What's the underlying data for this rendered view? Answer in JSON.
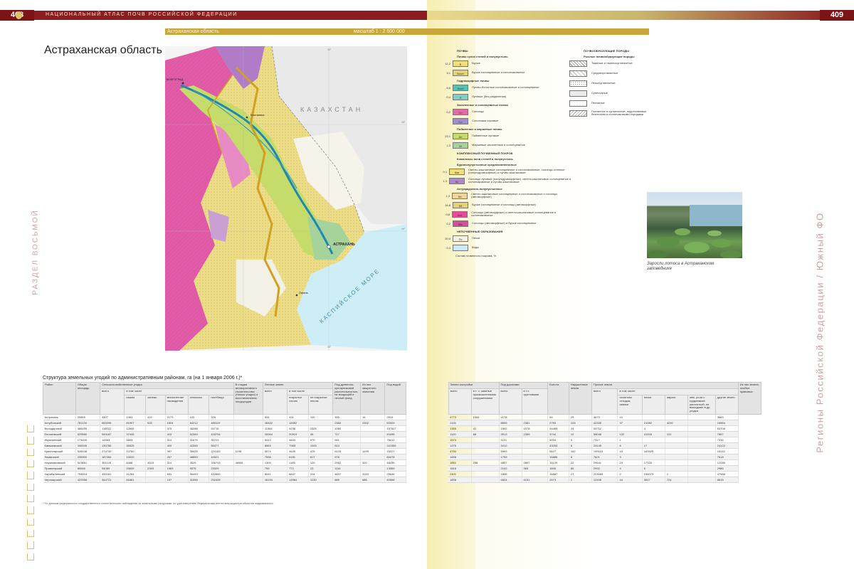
{
  "header": {
    "left_page": "408",
    "right_page": "409",
    "atlas_title": "НАЦИОНАЛЬНЫЙ АТЛАС ПОЧВ РОССИЙСКОЙ ФЕДЕРАЦИИ",
    "map_strip_label": "Астраханская область",
    "map_strip_scale": "масштаб 1 : 2 500 000"
  },
  "region_title": "Астраханская область",
  "side": {
    "left": "РАЗДЕЛ ВОСЬМОЙ",
    "right": "Регионы Российской Федерации / Южный ФО"
  },
  "map": {
    "labels": {
      "kazakhstan": "КАЗАХСТАН",
      "caspian": "КАСПИЙСКОЕ МОРЕ",
      "astrakhan": "АСТРАХАНЬ",
      "volgograd_region": "ВОЛГОГРАД",
      "enotaevka": "Енотаевка",
      "lagan": "Лагань"
    },
    "grid": [
      "46°",
      "47°",
      "48°",
      "49°",
      "50°",
      "45°"
    ]
  },
  "legend": {
    "soils_title": "ПОЧВЫ",
    "group1": "Почвы сухих степей и полупустынь",
    "rows": [
      {
        "n": "12,2",
        "code": "Б",
        "text": "Бурые",
        "color": "#f1e07a"
      },
      {
        "n": "5,1",
        "code": "Бсол",
        "text": "Бурые солонцеватые и солончаковатые",
        "color": "#e9d36a"
      },
      {
        "head": "Гидроморфные почвы"
      },
      {
        "n": "6,6",
        "code": "Лсол",
        "text": "Лугово-болотные солончаковатые и солонцеватые",
        "color": "#53c4b4"
      },
      {
        "n": "0,4",
        "code": "Л",
        "text": "Луговые (без разделения)",
        "color": "#7fcfc5"
      },
      {
        "head": "Засоленные и солонцеватые почвы"
      },
      {
        "n": "0,2",
        "code": "Сн",
        "text": "Солонцы",
        "color": "#e56aa9"
      },
      {
        "n": "",
        "code": "Сл",
        "text": "Солончаки соровые",
        "color": "#a58bcf"
      },
      {
        "head": "Пойменные и маршевые почвы"
      },
      {
        "n": "23,1",
        "code": "Ап",
        "text": "Пойменные луговые",
        "color": "#c5dc6a"
      },
      {
        "n": "1,3",
        "code": "М",
        "text": "Маршевые засоленные и солонцеватые",
        "color": "#a6d39a"
      },
      {
        "head": "КОМПЛЕКСНЫЙ ПОЧВЕННЫЙ ПОКРОВ"
      },
      {
        "head": "Комплексы почв степей и полупустынь"
      },
      {
        "head": "Бурополупустынные среднекомплексные"
      },
      {
        "n": "0,1",
        "code": "Ккв",
        "text": "Светло-каштановые солонцеватые и солончаковатые, солонцы степные (полугидроморфные) и лугово-каштановые",
        "color": "#f1e07a"
      },
      {
        "n": "1,3",
        "code": "Кс",
        "text": "Солонцы луговые (полугидроморфные), светло-каштановые солонцеватые и солончаковатые и лугово-каштановые",
        "color": "#b485cf"
      },
      {
        "head": "Ахтуарадзенно-полупустынные"
      },
      {
        "n": "1,3",
        "code": "Кп",
        "text": "Светло-каштановые солонцеватые и солончаковатые и солонцы (автоморфные)",
        "color": "#edd89a"
      },
      {
        "n": "16,8",
        "code": "Кб",
        "text": "Бурые солонцеватые и солонцы (автоморфные)",
        "color": "#e8d070"
      },
      {
        "n": "0,8",
        "code": "Ксн",
        "text": "Солонцы (автоморфные) и светло-каштановые солонцеватые и солончаковатые",
        "color": "#e84aa0"
      },
      {
        "n": "0,2",
        "code": "Кбс",
        "text": "Солонцы (автоморфные) и бурые солонцеватые",
        "color": "#d84c9c"
      },
      {
        "head": "НЕПОЧВЕННЫЕ ОБРАЗОВАНИЯ"
      },
      {
        "n": "20,0",
        "code": "Пс",
        "text": "Пески",
        "color": "#f3f1e6"
      },
      {
        "n": "0,4",
        "code": "",
        "text": "Воды",
        "color": "#c8ecf6"
      }
    ],
    "note": "Состав почвенного покрова, %"
  },
  "legend_rocks": {
    "title": "ПОЧВООБРАЗУЮЩИЕ ПОРОДЫ",
    "subtitle": "Рыхлые почвообразующие породы",
    "rows": [
      "Тяжелые и тяжелосуглинистые",
      "Среднесуглинистые",
      "Легкосуглинистые",
      "Супесчаные",
      "Песчаные",
      "Глинистые и суглинистые, подстилаемые безлесьем и солончаковыми породами"
    ]
  },
  "photo_caption": "Заросли лотоса в Астраханском заповеднике",
  "table": {
    "title": "Структура земельных угодий по административным районам, га (на 1 января 2006 г.)*",
    "h_district": "Район",
    "h_total": "Общая площадь",
    "h_agri": "Сельскохозяйственные угодья",
    "h_agri_all": "всего",
    "h_incl": "в том числе",
    "h_arable": "пашня",
    "h_fallow": "залежь",
    "h_perennial": "многолетние насаждения",
    "h_hay": "сенокосы",
    "h_pasture": "пастбища",
    "h_constr": "В стадии мелиоративного строительства (только угодья) и восстановления плодородия",
    "h_forest": "Лесные земли",
    "h_forest_all": "всего",
    "h_forest_incl": "в том числе",
    "h_forest_cov": "покрытые лесом",
    "h_forest_nc": "не покрытые лесом",
    "h_trees": "Под древесно-кустарниковой растительностью, не входящей в лесной фонд",
    "h_protect": "Из них защитного значения",
    "h_water": "Под водой",
    "h_build": "Земли застройки",
    "h_build_all": "всего",
    "h_build_ind": "в т. ч. занятые промышленными сооружениями",
    "h_roads": "Под дорогами",
    "h_roads_all": "всего",
    "h_roads_dirt": "в т.ч. грунтовыми",
    "h_swamp": "Болота",
    "h_disturbed": "Нарушенные земли",
    "h_other": "Прочие земли",
    "h_other_all": "всего",
    "h_other_incl": "в том числе",
    "h_other_water": "полигоны отходов, свалки",
    "h_other_sand": "пески",
    "h_other_ravine": "овраги",
    "h_other_rocks": "зем. уч-ки с трудоемкой расчисткой, не вошедшие в др. угодья",
    "h_other_else": "другие земли",
    "h_outside": "Из них земель особых правовых",
    "rows": [
      [
        "Астрахань",
        "20809",
        "4407",
        "1381",
        "422",
        "2173",
        "103",
        "328",
        "",
        "531",
        "431",
        "100",
        "305",
        "16",
        "2919",
        "4773",
        "1544",
        "4178",
        "",
        "54",
        "29",
        "3673",
        "10",
        "",
        "",
        "",
        "3663"
      ],
      [
        "Ахтубинский",
        "781134",
        "653295",
        "81907",
        "533",
        "1504",
        "84212",
        "485119",
        "",
        "18452",
        "18452",
        "",
        "2382",
        "2302",
        "50929",
        "2431",
        "",
        "8505",
        "2381",
        "2759",
        "126",
        "42335",
        "37",
        "21082",
        "4232",
        "",
        "16984"
      ],
      [
        "Володарский",
        "388255",
        "116022",
        "12845",
        "",
        "375",
        "48288",
        "53715",
        "",
        "11564",
        "9238",
        "2326",
        "1080",
        "",
        "157827",
        "1355",
        "41",
        "1502",
        "1078",
        "44483",
        "24",
        "53712",
        "",
        "4",
        "",
        "",
        "53708"
      ],
      [
        "Енотаевский",
        "629580",
        "549187",
        "37445",
        "",
        "415",
        "52369",
        "418754",
        "",
        "20964",
        "20919",
        "45",
        "717",
        "",
        "40495",
        "1120",
        "88",
        "3913",
        "2359",
        "3744",
        "12",
        "58048",
        "132",
        "41928",
        "131",
        "",
        "7857"
      ],
      [
        "Икрянинский",
        "174400",
        "14563",
        "5853",
        "",
        "314",
        "31675",
        "35721",
        "",
        "5413",
        "4843",
        "570",
        "541",
        "",
        "78412",
        "1574",
        "",
        "1121",
        "",
        "5054",
        "5",
        "7317",
        "1",
        "",
        "",
        "",
        "7316"
      ],
      [
        "Камызякский",
        "348345",
        "130786",
        "36525",
        "",
        "400",
        "42355",
        "55477",
        "",
        "8983",
        "7983",
        "1000",
        "813",
        "",
        "110359",
        "1476",
        "",
        "3412",
        "",
        "43253",
        "6",
        "24145",
        "6",
        "17",
        "",
        "",
        "24122"
      ],
      [
        "Красноярский",
        "526048",
        "274740",
        "10760",
        "",
        "397",
        "38428",
        "224163",
        "1198",
        "5074",
        "4649",
        "425",
        "6133",
        "1499",
        "15227",
        "4783",
        "",
        "5993",
        "",
        "5627",
        "162",
        "199110",
        "43",
        "183925",
        "",
        "",
        "15142"
      ],
      [
        "Лиманский",
        "235900",
        "187264",
        "15020",
        "",
        "267",
        "48850",
        "44521",
        "",
        "7598",
        "6181",
        "817",
        "578",
        "",
        "89478",
        "1698",
        "",
        "1759",
        "",
        "15886",
        "8",
        "7621",
        "3",
        "",
        "",
        "",
        "7618"
      ],
      [
        "Наримановский",
        "523851",
        "351126",
        "8458",
        "4618",
        "314",
        "3525",
        "336703",
        "46581",
        "1305",
        "1185",
        "120",
        "2952",
        "320",
        "48255",
        "1851",
        "208",
        "4857",
        "2897",
        "15129",
        "22",
        "29641",
        "23",
        "17333",
        "",
        "",
        "12285"
      ],
      [
        "Приволжский",
        "80646",
        "54069",
        "20839",
        "2343",
        "1983",
        "5575",
        "23329",
        "",
        "795",
        "772",
        "23",
        "1116",
        "",
        "13069",
        "1818",
        "",
        "2102",
        "365",
        "1808",
        "85",
        "2992",
        "4",
        "6",
        "",
        "",
        "2986"
      ],
      [
        "Харабалинский",
        "754618",
        "490181",
        "41284",
        "",
        "831",
        "56490",
        "432883",
        "",
        "8041",
        "8837",
        "204",
        "4697",
        "3153",
        "29646",
        "2401",
        "",
        "1808",
        "",
        "16887",
        "27",
        "203065",
        "2",
        "155073",
        "2",
        "",
        "47988"
      ],
      [
        "Черноярский",
        "422958",
        "344721",
        "81661",
        "",
        "197",
        "31558",
        "232405",
        "",
        "16194",
        "14964",
        "1230",
        "689",
        "686",
        "40558",
        "1898",
        "",
        "4824",
        "4151",
        "2573",
        "1",
        "12408",
        "44",
        "3817",
        "724",
        "",
        "8615"
      ]
    ]
  },
  "footnote": "* По данным федерального государственного статистического наблюдения за земельными ресурсами, по удостоверению Федеральным агентством кадастра объектов недвижимости."
}
